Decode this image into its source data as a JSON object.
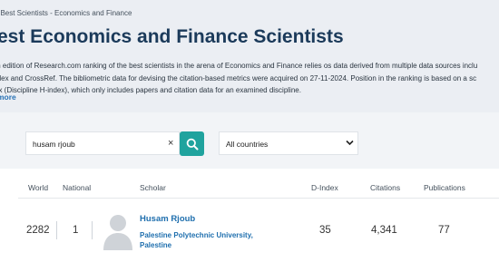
{
  "breadcrumb": "f Best Scientists - Economics and Finance",
  "page_title": "est Economics and Finance Scientists",
  "description": [
    "th edition of Research.com ranking of the best scientists in the arena of Economics and Finance relies os data derived from multiple data sources inclu",
    "Alex and CrossRef. The bibliometric data for devising the citation-based metrics were acquired on 27-11-2024. Position in the ranking is based on a sc",
    "ex (Discipline H-index), which only includes papers and citation data for an examined discipline."
  ],
  "more_link": "more",
  "search": {
    "value": "husam rjoub",
    "clear_symbol": "×",
    "button_icon": "search-icon"
  },
  "country_filter": {
    "selected": "All countries"
  },
  "table": {
    "headers": {
      "world": "World",
      "national": "National",
      "scholar": "Scholar",
      "dindex": "D-Index",
      "citations": "Citations",
      "publications": "Publications"
    },
    "rows": [
      {
        "world": "2282",
        "national": "1",
        "name": "Husam Rjoub",
        "affiliation": "Palestine Polytechnic University, Palestine",
        "dindex": "35",
        "citations": "4,341",
        "publications": "77"
      }
    ]
  },
  "colors": {
    "accent": "#20a39e",
    "link": "#1f6fae",
    "title": "#1b3a5a",
    "hero_bg": "#ebeef3"
  }
}
